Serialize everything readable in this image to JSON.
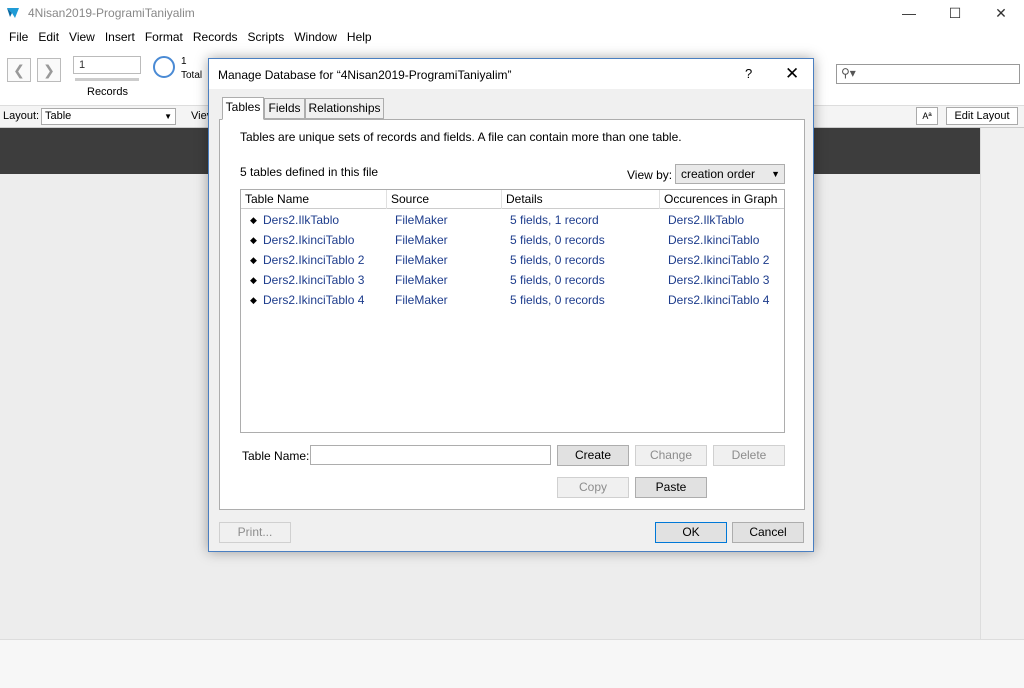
{
  "app": {
    "title": "4Nisan2019-ProgramiTaniyalim",
    "icon": "filemaker-icon"
  },
  "menu": [
    "File",
    "Edit",
    "View",
    "Insert",
    "Format",
    "Records",
    "Scripts",
    "Window",
    "Help"
  ],
  "toolbar": {
    "record_value": "1",
    "records_label": "Records",
    "total_count": "1",
    "total_label": "Total"
  },
  "layoutbar": {
    "layout_label": "Layout:",
    "layout_value": "Table",
    "view_label": "Viev",
    "aa_label": "Aª",
    "edit_layout_label": "Edit Layout"
  },
  "dialog": {
    "title": "Manage Database for “4Nisan2019-ProgramiTaniyalim”",
    "help": "?",
    "close": "✕",
    "tabs": [
      "Tables",
      "Fields",
      "Relationships"
    ],
    "active_tab": "Tables",
    "description": "Tables are unique sets of records and fields. A file can contain more than one table.",
    "count_text": "5 tables defined in this file",
    "view_by_label": "View by:",
    "view_by_value": "creation order",
    "columns": [
      "Table Name",
      "Source",
      "Details",
      "Occurences in Graph"
    ],
    "rows": [
      {
        "name": "Ders2.IlkTablo",
        "source": "FileMaker",
        "details": "5 fields, 1 record",
        "occurrences": "Ders2.IlkTablo"
      },
      {
        "name": "Ders2.IkinciTablo",
        "source": "FileMaker",
        "details": "5 fields, 0 records",
        "occurrences": "Ders2.IkinciTablo"
      },
      {
        "name": "Ders2.IkinciTablo 2",
        "source": "FileMaker",
        "details": "5 fields, 0 records",
        "occurrences": "Ders2.IkinciTablo 2"
      },
      {
        "name": "Ders2.IkinciTablo 3",
        "source": "FileMaker",
        "details": "5 fields, 0 records",
        "occurrences": "Ders2.IkinciTablo 3"
      },
      {
        "name": "Ders2.IkinciTablo 4",
        "source": "FileMaker",
        "details": "5 fields, 0 records",
        "occurrences": "Ders2.IkinciTablo 4"
      }
    ],
    "table_name_label": "Table Name:",
    "table_name_value": "",
    "buttons": {
      "create": "Create",
      "change": "Change",
      "delete": "Delete",
      "copy": "Copy",
      "paste": "Paste",
      "print": "Print...",
      "ok": "OK",
      "cancel": "Cancel"
    }
  },
  "colors": {
    "accent": "#0078d7",
    "link_text": "#1d3c8c",
    "dark_band": "#3d3d3d"
  }
}
